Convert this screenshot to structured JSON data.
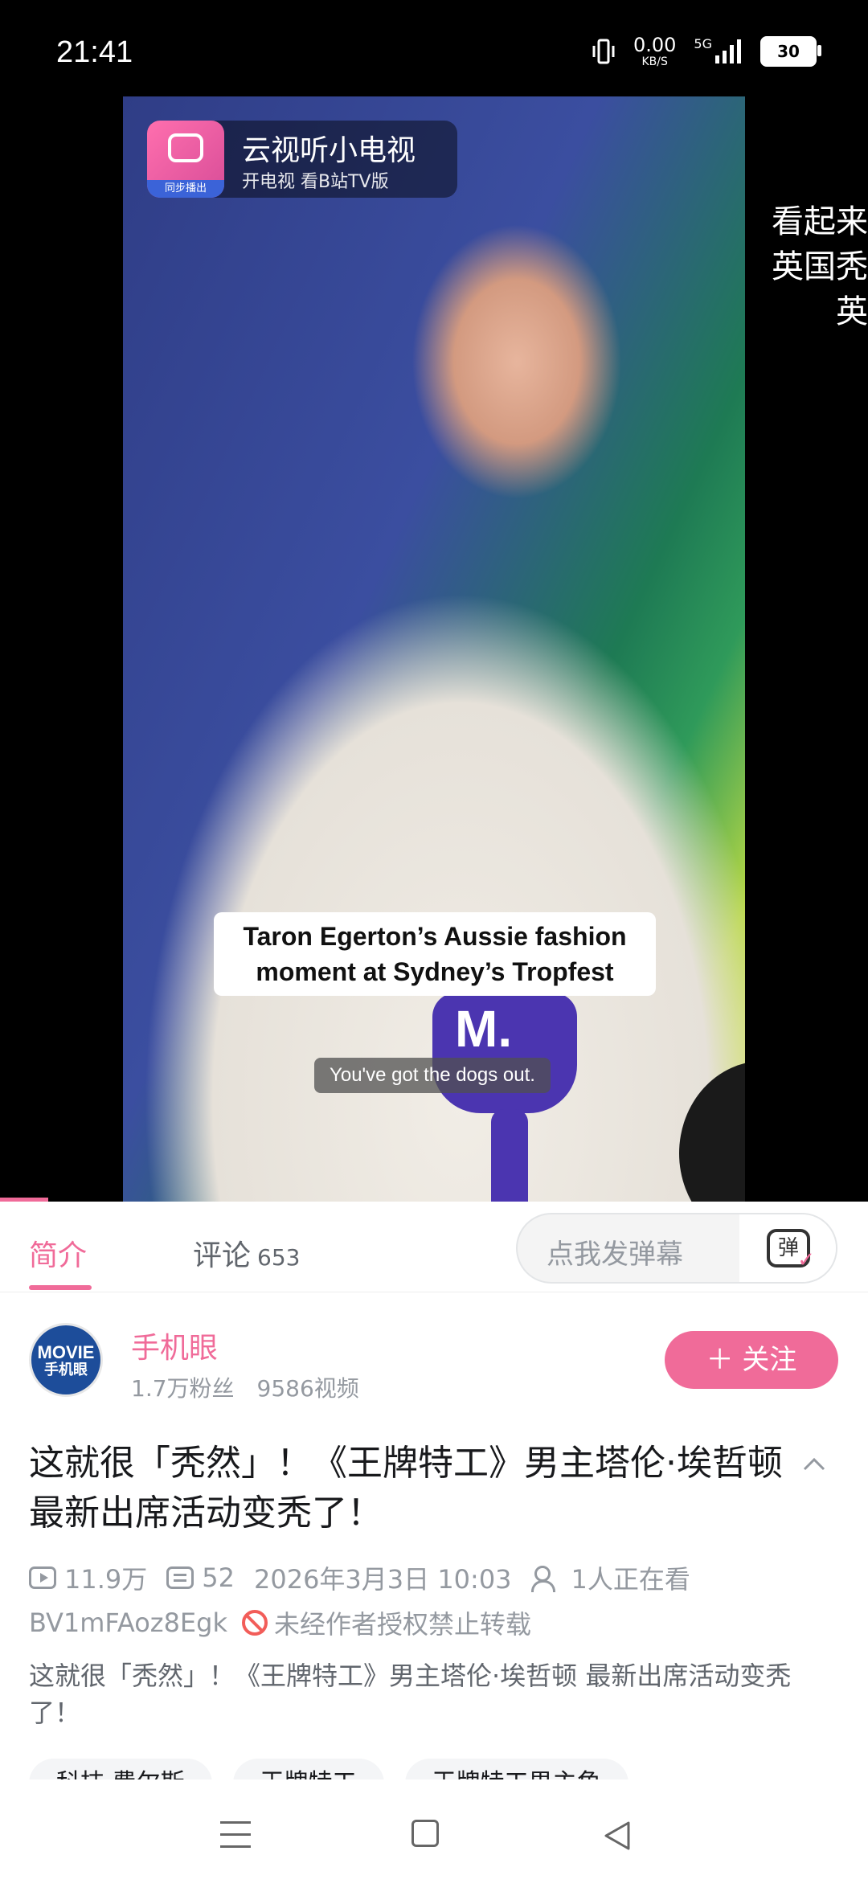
{
  "status_bar": {
    "time": "21:41",
    "net_speed_value": "0.00",
    "net_speed_unit": "KB/S",
    "network": "5G",
    "battery": "30"
  },
  "player": {
    "tv_badge_title": "云视听小电视",
    "tv_badge_subtitle": "开电视 看B站TV版",
    "tv_badge_sync": "同步播出",
    "side_text_lines": [
      "看起来",
      "英国秃",
      "英"
    ],
    "caption_line1": "Taron Egerton’s Aussie fashion",
    "caption_line2": "moment at Sydney’s Tropfest",
    "subtitle": "You've got the dogs out.",
    "mic_letter": "M."
  },
  "tabs": {
    "intro_label": "简介",
    "comments_label": "评论",
    "comments_count": "653",
    "danmaku_placeholder": "点我发弹幕",
    "danmaku_toggle_label": "弹"
  },
  "author": {
    "name": "手机眼",
    "followers": "1.7万粉丝",
    "videos": "9586视频",
    "follow_label": "＋ 关注",
    "avatar_line1": "MOVIE",
    "avatar_line2": "手机眼"
  },
  "video": {
    "title": "这就很「秃然」！《王牌特工》男主塔伦·埃哲顿 最新出席活动变秃了！",
    "views": "11.9万",
    "danmaku_count": "52",
    "date": "2026年3月3日 10:03",
    "watching": "1人正在看",
    "bvid": "BV1mFAoz8Egk",
    "copyright_notice": "未经作者授权禁止转载",
    "description": "这就很「秃然」！《王牌特工》男主塔伦·埃哲顿 最新出席活动变秃了！",
    "tags": [
      "科技·费尔斯",
      "王牌特工",
      "王牌特工男主角"
    ]
  },
  "colors": {
    "accent": "#f06b99",
    "text_primary": "#18191c",
    "text_secondary": "#9499a0",
    "warning": "#f25d59"
  }
}
